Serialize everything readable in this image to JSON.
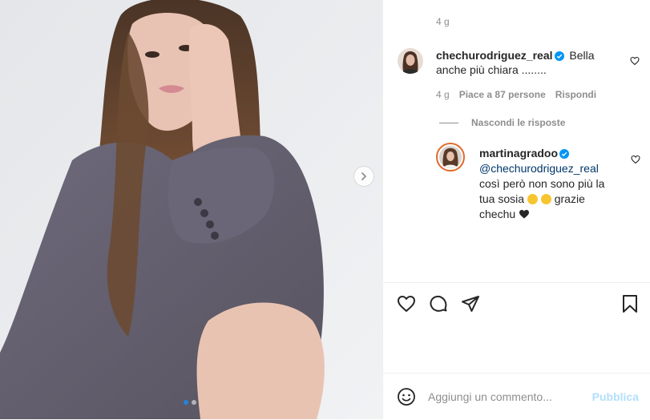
{
  "previous_comment": {
    "time": "4 g"
  },
  "comment": {
    "username": "chechurodriguez_real",
    "text": "Bella anche più chiara ........",
    "time": "4 g",
    "likes": "Piace a 87 persone",
    "reply_label": "Rispondi"
  },
  "hide_replies_label": "Nascondi le risposte",
  "reply": {
    "username": "martinagradoo",
    "mention": "@chechurodriguez_real",
    "text_line": "così però non sono più la tua sosia",
    "text_end": "grazie chechu"
  },
  "composer": {
    "placeholder": "Aggiungi un commento...",
    "publish_label": "Pubblica"
  },
  "carousel": {
    "slides": 2,
    "active": 1
  },
  "colors": {
    "verified": "#0095f6",
    "link": "#00376b",
    "publish_disabled": "#b2dffc",
    "muted": "#8e8e8e"
  },
  "icons": [
    "heart-icon",
    "comment-icon",
    "share-icon",
    "bookmark-icon",
    "emoji-icon",
    "chevron-right-icon",
    "verified-icon"
  ]
}
